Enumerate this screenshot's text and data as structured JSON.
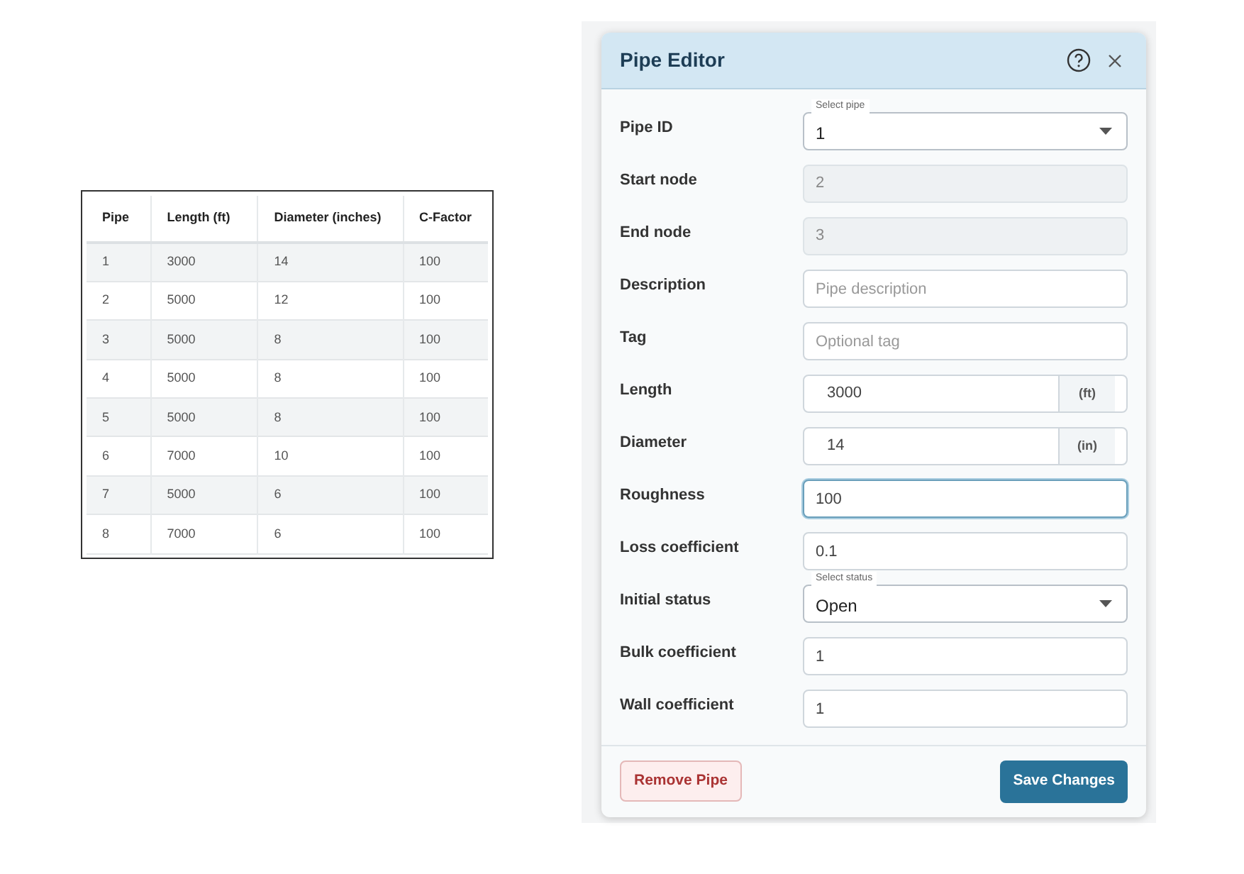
{
  "table": {
    "columns": [
      "Pipe",
      "Length (ft)",
      "Diameter (inches)",
      "C-Factor"
    ],
    "rows": [
      [
        "1",
        "3000",
        "14",
        "100"
      ],
      [
        "2",
        "5000",
        "12",
        "100"
      ],
      [
        "3",
        "5000",
        "8",
        "100"
      ],
      [
        "4",
        "5000",
        "8",
        "100"
      ],
      [
        "5",
        "5000",
        "8",
        "100"
      ],
      [
        "6",
        "7000",
        "10",
        "100"
      ],
      [
        "7",
        "5000",
        "6",
        "100"
      ],
      [
        "8",
        "7000",
        "6",
        "100"
      ]
    ]
  },
  "dialog": {
    "title": "Pipe Editor",
    "fields": [
      {
        "label": "Pipe ID",
        "kind": "select",
        "floating_label": "Select pipe",
        "value": "1"
      },
      {
        "label": "Start node",
        "kind": "readonly",
        "value": "2"
      },
      {
        "label": "End node",
        "kind": "readonly",
        "value": "3"
      },
      {
        "label": "Description",
        "kind": "text",
        "placeholder": "Pipe description"
      },
      {
        "label": "Tag",
        "kind": "text",
        "placeholder": "Optional tag"
      },
      {
        "label": "Length",
        "kind": "unit",
        "value": "3000",
        "unit": "(ft)"
      },
      {
        "label": "Diameter",
        "kind": "unit",
        "value": "14",
        "unit": "(in)"
      },
      {
        "label": "Roughness",
        "kind": "text",
        "value": "100",
        "focused": true
      },
      {
        "label": "Loss coefficient",
        "kind": "text",
        "value": "0.1"
      },
      {
        "label": "Initial status",
        "kind": "select",
        "floating_label": "Select status",
        "value": "Open"
      },
      {
        "label": "Bulk coefficient",
        "kind": "text",
        "value": "1"
      },
      {
        "label": "Wall coefficient",
        "kind": "text",
        "value": "1"
      }
    ],
    "buttons": {
      "remove": "Remove Pipe",
      "save": "Save Changes"
    }
  }
}
